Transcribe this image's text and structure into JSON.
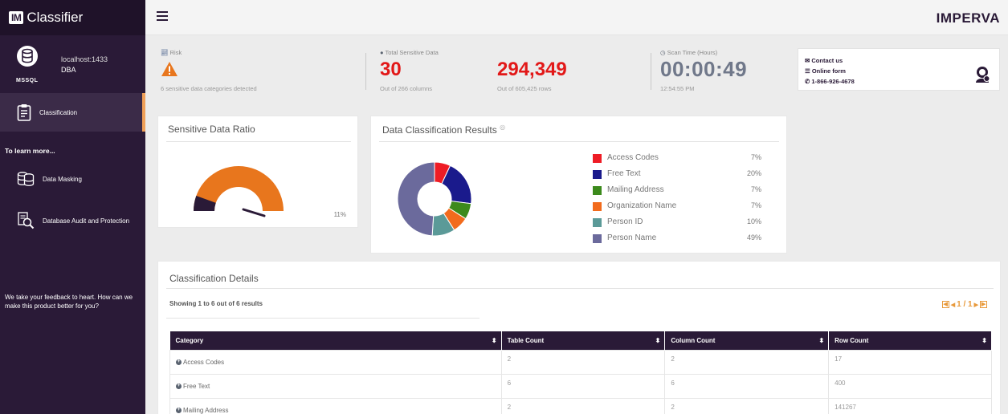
{
  "app": {
    "brand_badge": "IM",
    "brand_name": "Classifier"
  },
  "database": {
    "type": "MSSQL",
    "host": "localhost:1433",
    "user": "DBA"
  },
  "sidebar": {
    "active_item": "Classification",
    "learn_more": "To learn more...",
    "links": [
      "Data Masking",
      "Database Audit and Protection"
    ],
    "feedback": "We take your feedback to heart. How can we make this product better for you?"
  },
  "header": {
    "logo": "IMPERVA"
  },
  "stats": {
    "risk": {
      "label": "Risk",
      "sub": "6 sensitive data categories detected"
    },
    "sensitive": {
      "label": "Total Sensitive Data",
      "columns_value": "30",
      "columns_sub": "Out of 266 columns",
      "rows_value": "294,349",
      "rows_sub": "Out of 605,425 rows"
    },
    "scan": {
      "label": "Scan Time (Hours)",
      "value": "00:00:49",
      "sub": "12:54:55 PM"
    }
  },
  "contact": {
    "contact_us": "Contact us",
    "online_form": "Online form",
    "phone": "1-866-926-4678"
  },
  "ratio_card": {
    "title": "Sensitive Data Ratio",
    "value_label": "11%",
    "ratio": 0.11
  },
  "results_card": {
    "title": "Data Classification Results"
  },
  "chart_data": {
    "type": "pie",
    "title": "Data Classification Results",
    "categories": [
      "Access Codes",
      "Free Text",
      "Mailing Address",
      "Organization Name",
      "Person ID",
      "Person Name"
    ],
    "values": [
      7,
      20,
      7,
      7,
      10,
      49
    ],
    "labels": [
      "7%",
      "20%",
      "7%",
      "7%",
      "10%",
      "49%"
    ],
    "colors": [
      "#ee1c25",
      "#1a1a8c",
      "#3c8a1c",
      "#f26b1d",
      "#5b9a98",
      "#6b6a9c"
    ],
    "donut": true,
    "legend": "right"
  },
  "details": {
    "title": "Classification Details",
    "showing": "Showing 1 to 6 out of 6 results",
    "pager": "1 / 1",
    "columns": [
      "Category",
      "Table Count",
      "Column Count",
      "Row Count"
    ],
    "rows": [
      {
        "category": "Access Codes",
        "table_count": "2",
        "column_count": "2",
        "row_count": "17"
      },
      {
        "category": "Free Text",
        "table_count": "6",
        "column_count": "6",
        "row_count": "400"
      },
      {
        "category": "Mailing Address",
        "table_count": "2",
        "column_count": "2",
        "row_count": "141267"
      }
    ]
  },
  "colors": {
    "sidebar": "#2a1a37",
    "accent_orange": "#e8761d",
    "alert_red": "#e21818"
  }
}
